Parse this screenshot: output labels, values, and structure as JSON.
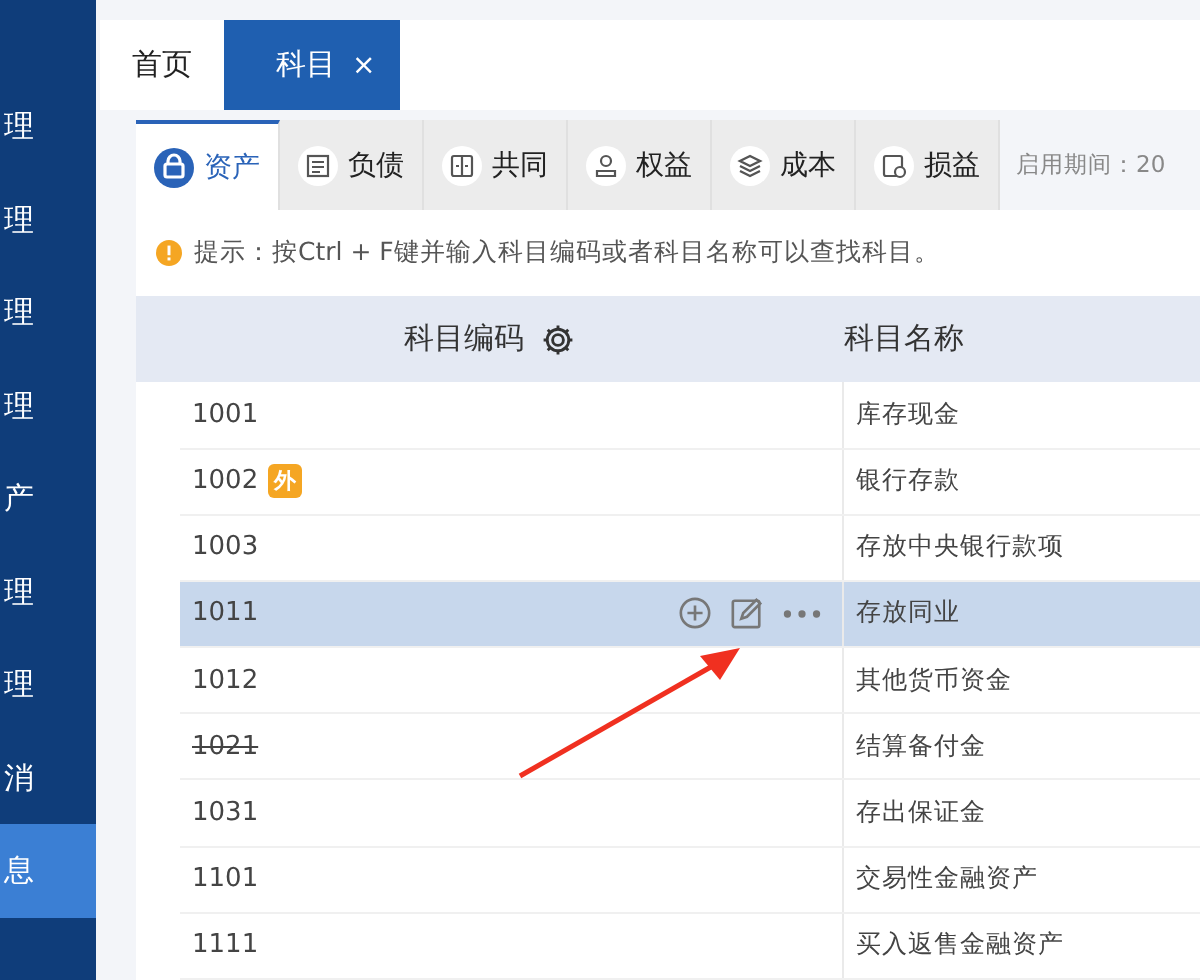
{
  "sidebar": {
    "items": [
      {
        "label": "理",
        "selected": false
      },
      {
        "label": "理",
        "selected": false
      },
      {
        "label": "理",
        "selected": false
      },
      {
        "label": "理",
        "selected": false
      },
      {
        "label": "产",
        "selected": false
      },
      {
        "label": "理",
        "selected": false
      },
      {
        "label": "理",
        "selected": false
      },
      {
        "label": "消",
        "selected": false
      },
      {
        "label": "息",
        "selected": true
      }
    ]
  },
  "page_tabs": [
    {
      "label": "首页",
      "selected": false,
      "closable": false
    },
    {
      "label": "科目",
      "selected": true,
      "closable": true,
      "close": "×"
    }
  ],
  "category_tabs": [
    {
      "label": "资产",
      "selected": true
    },
    {
      "label": "负债",
      "selected": false
    },
    {
      "label": "共同",
      "selected": false
    },
    {
      "label": "权益",
      "selected": false
    },
    {
      "label": "成本",
      "selected": false
    },
    {
      "label": "损益",
      "selected": false
    }
  ],
  "period_label": "启用期间：20",
  "hint": "提示：按Ctrl + F键并输入科目编码或者科目名称可以查找科目。",
  "table": {
    "columns": [
      "科目编码",
      "科目名称"
    ],
    "rows": [
      {
        "code": "1001",
        "name": "库存现金",
        "selected": false,
        "struck": false
      },
      {
        "code": "1002",
        "badge": "外",
        "name": "银行存款",
        "selected": false,
        "struck": false
      },
      {
        "code": "1003",
        "name": "存放中央银行款项",
        "selected": false,
        "struck": false
      },
      {
        "code": "1011",
        "name": "存放同业",
        "selected": true,
        "struck": false,
        "actions": true
      },
      {
        "code": "1012",
        "name": "其他货币资金",
        "selected": false,
        "struck": false
      },
      {
        "code": "1021",
        "name": "结算备付金",
        "selected": false,
        "struck": true
      },
      {
        "code": "1031",
        "name": "存出保证金",
        "selected": false,
        "struck": false
      },
      {
        "code": "1101",
        "name": "交易性金融资产",
        "selected": false,
        "struck": false
      },
      {
        "code": "1111",
        "name": "买入返售金融资产",
        "selected": false,
        "struck": false
      }
    ]
  }
}
